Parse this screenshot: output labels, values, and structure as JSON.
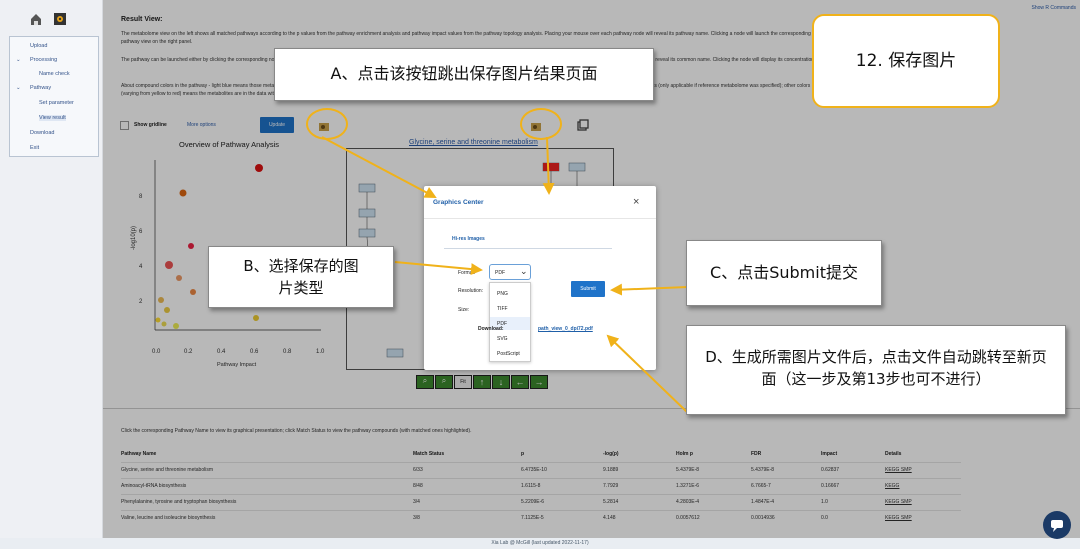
{
  "sidebar": {
    "items": [
      {
        "label": "Upload"
      },
      {
        "label": "Processing"
      },
      {
        "label": "Name check"
      },
      {
        "label": "Pathway"
      },
      {
        "label": "Set parameter"
      },
      {
        "label": "View result"
      },
      {
        "label": "Download"
      },
      {
        "label": "Exit"
      }
    ]
  },
  "header": {
    "show_commands": "Show R Commands"
  },
  "result": {
    "title": "Result View:",
    "para1_bold": "metabolome view",
    "para1": "The metabolome view on the left shows all matched pathways according to the p values from the pathway enrichment analysis and pathway impact values from the pathway topology analysis. Placing your mouse over each pathway node will reveal its pathway name. Clicking a node will launch the corresponding pathway view on the right panel.",
    "para2": "The pathway can be launched either by clicking the corresponding node on the metabolome view or from the table below. The pathway view can zoom in and out using the control buttons below, and then mouse over each metabolite node will reveal its common name. Clicking the node will display its concentration",
    "para3": "About compound colors in the pathway - light blue means those metabolites are not in your data and are used as background for enrichment analysis; grey means the metabolite is not in your data and is also excluded from enrichment analysis (only applicable if reference metabolome was specified); other colors (varying from yellow to red) means the metabolites are in the data with different levels of significance."
  },
  "controls": {
    "show_gridline": "Show gridline",
    "more_options": "More options",
    "update": "Update"
  },
  "overview_chart": {
    "title": "Overview of Pathway Analysis",
    "xlabel": "Pathway Impact",
    "ylabel": "-log10(p)"
  },
  "pathway_view": {
    "title": "Glycine, serine and threonine metabolism",
    "nodes": [
      "C00122",
      "C00037",
      "C00065",
      "C00188",
      "C01005",
      "C00258",
      "C00581",
      "C00430"
    ],
    "controls": [
      "zoom-in",
      "zoom-out",
      "fit",
      "up",
      "down",
      "left",
      "right"
    ],
    "fit_label": "Fit"
  },
  "modal": {
    "title": "Graphics Center",
    "tab": "Hi-res Images",
    "format_label": "Format:",
    "resolution_label": "Resolution:",
    "size_label": "Size:",
    "format_value": "PDF",
    "options": [
      "PNG",
      "TIFF",
      "PDF",
      "SVG",
      "PostScript"
    ],
    "submit": "Submit",
    "download_prefix": "Download:",
    "download_link": "path_view_0_dpi72.pdf"
  },
  "annotations": {
    "a": "A、点击该按钮跳出保存图片结果页面",
    "b": "B、选择保存的图片类型",
    "c": "C、点击Submit提交",
    "d": "D、生成所需图片文件后，点击文件自动跳转至新页面（这一步及第13步也可不进行）",
    "step": "12. 保存图片"
  },
  "table": {
    "intro": "Click the corresponding Pathway Name to view its graphical presentation; click Match Status to view the pathway compounds (with matched ones highlighted).",
    "headers": [
      "Pathway Name",
      "Match Status",
      "p",
      "-log(p)",
      "Holm p",
      "FDR",
      "Impact",
      "Details"
    ],
    "rows": [
      [
        "Glycine, serine and threonine metabolism",
        "6/33",
        "6.4735E-10",
        "9.1889",
        "5.4379E-8",
        "5.4379E-8",
        "0.62837",
        "KEGG SMP"
      ],
      [
        "Aminoacyl-tRNA biosynthesis",
        "8/48",
        "1.6115-8",
        "7.7929",
        "1.3271E-6",
        "6.7665-7",
        "0.16667",
        "KEGG"
      ],
      [
        "Phenylalanine, tyrosine and tryptophan biosynthesis",
        "3/4",
        "5.2209E-6",
        "5.2814",
        "4.2803E-4",
        "1.4847E-4",
        "1.0",
        "KEGG SMP"
      ],
      [
        "Valine, leucine and isoleucine biosynthesis",
        "3/8",
        "7.1125E-5",
        "4.148",
        "0.0057612",
        "0.0014936",
        "0.0",
        "KEGG SMP"
      ]
    ]
  },
  "footer": {
    "lab": "Xia Lab @ McGill",
    "updated": "(last updated 2022-11-17)"
  },
  "colors": {
    "accent": "#f0b21a",
    "link": "#2a5aa8",
    "button": "#1f73c9"
  },
  "icons": [
    "home-icon",
    "settings-icon",
    "image-save-icon",
    "copy-icon",
    "chat-icon",
    "close-icon",
    "chevron-down-icon"
  ]
}
